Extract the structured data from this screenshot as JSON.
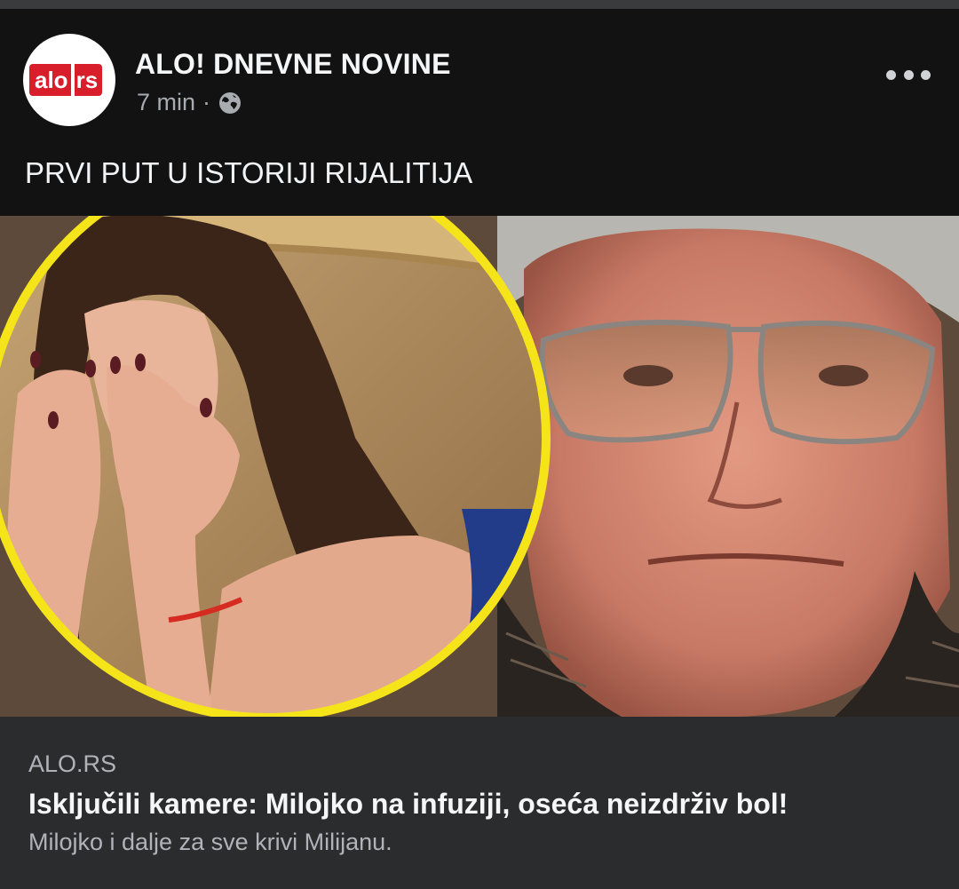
{
  "post": {
    "page_name": "ALO! DNEVNE NOVINE",
    "avatar_logo": {
      "left": "alo",
      "right": "rs"
    },
    "time": "7 min",
    "separator": "·",
    "audience_icon": "globe-icon",
    "more_icon": "more-options-icon",
    "text": "PRVI PUT U ISTORIJI RIJALITIJA"
  },
  "image": {
    "left_subject": "woman-covering-face",
    "right_subject": "man-with-glasses",
    "accent": "#f5e41a"
  },
  "link_preview": {
    "domain": "ALO.RS",
    "headline": "Isključili kamere: Milojko na infuziji, oseća neizdrživ bol!",
    "description": "Milojko i dalje za sve krivi Milijanu."
  },
  "colors": {
    "background": "#121212",
    "preview_background": "#2b2c2e",
    "brand_red": "#d81e2a"
  }
}
